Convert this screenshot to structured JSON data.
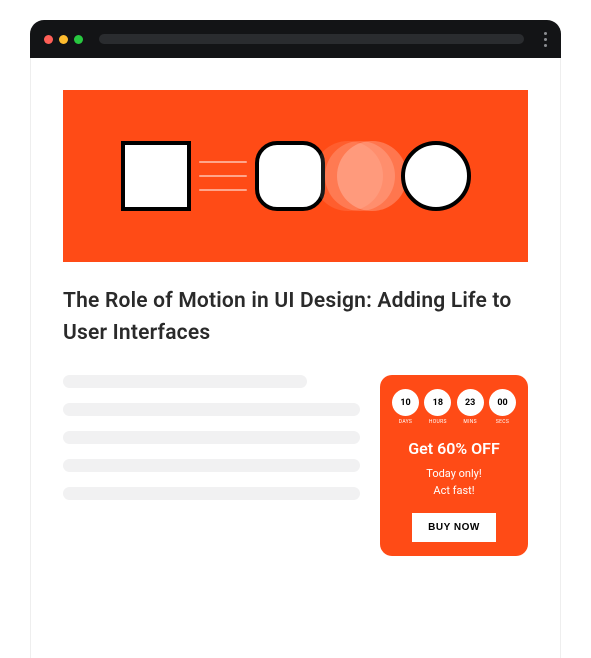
{
  "article": {
    "title": "The Role of Motion in UI Design: Adding Life to User Interfaces"
  },
  "promo": {
    "countdown": [
      {
        "value": "10",
        "label": "DAYS"
      },
      {
        "value": "18",
        "label": "HOURS"
      },
      {
        "value": "23",
        "label": "MINS"
      },
      {
        "value": "00",
        "label": "SECS"
      }
    ],
    "title": "Get 60% OFF",
    "subtitle_line1": "Today only!",
    "subtitle_line2": "Act fast!",
    "button_label": "BUY NOW"
  },
  "colors": {
    "accent": "#ff4b16"
  }
}
